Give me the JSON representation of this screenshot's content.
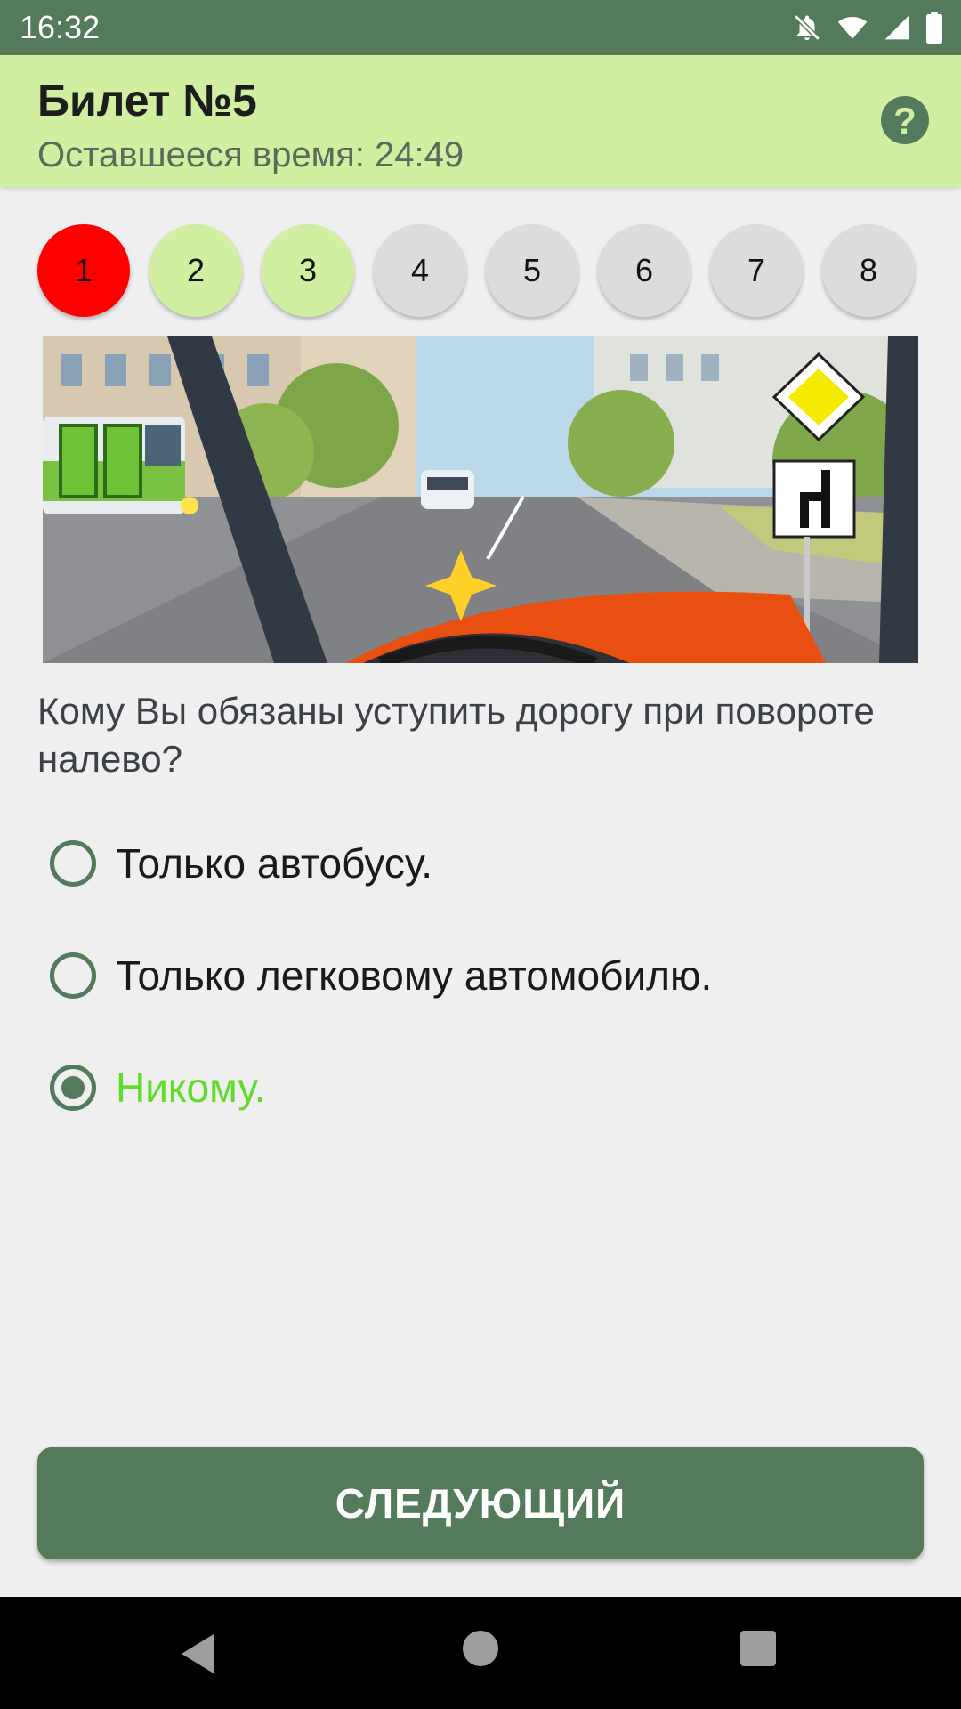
{
  "status_bar": {
    "time": "16:32",
    "icons": [
      "notifications-off-icon",
      "wifi-icon",
      "cellular-signal-icon",
      "battery-icon"
    ]
  },
  "header": {
    "title": "Билет №5",
    "time_label": "Оставшееся время:",
    "time_value": "24:49",
    "help_icon": "?"
  },
  "question_nav": [
    {
      "label": "1",
      "state": "wrong"
    },
    {
      "label": "2",
      "state": "answered"
    },
    {
      "label": "3",
      "state": "answered"
    },
    {
      "label": "4",
      "state": "pending"
    },
    {
      "label": "5",
      "state": "pending"
    },
    {
      "label": "6",
      "state": "pending"
    },
    {
      "label": "7",
      "state": "pending"
    },
    {
      "label": "8",
      "state": "pending"
    }
  ],
  "question": {
    "text": "Кому Вы обязаны уступить дорогу при повороте налево?",
    "answers": [
      {
        "label": "Только автобусу.",
        "selected": false
      },
      {
        "label": "Только легковому автомобилю.",
        "selected": false
      },
      {
        "label": "Никому.",
        "selected": true
      }
    ]
  },
  "next_button": "СЛЕДУЮЩИЙ",
  "colors": {
    "primary": "#527a5b",
    "header_bg": "#d1efa0",
    "wrong": "#ff0000",
    "correct_text": "#5fdb2a",
    "pending": "#dcdcdc"
  }
}
